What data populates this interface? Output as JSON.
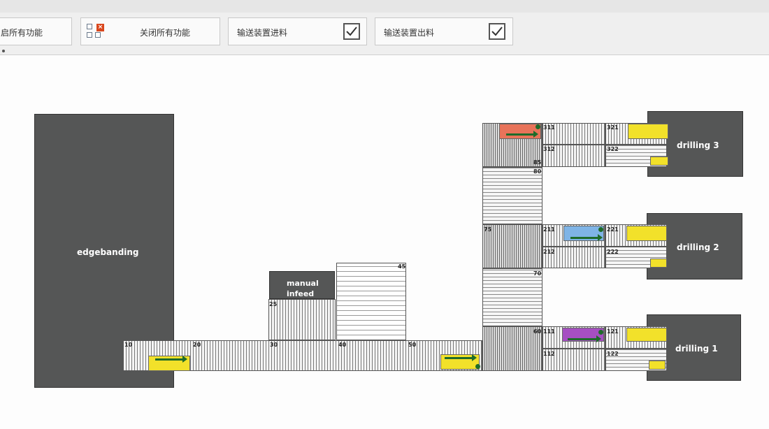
{
  "toolbar": {
    "btn_start_all": "启所有功能",
    "btn_stop_all": "关闭所有功能",
    "toggle_infeed": {
      "label": "输送装置进料",
      "checked": true
    },
    "toggle_outfeed": {
      "label": "输送装置出料",
      "checked": true
    }
  },
  "machines": {
    "edgebanding": "edgebanding",
    "manual_infeed": "manual infeed",
    "drilling_1": "drilling 1",
    "drilling_2": "drilling 2",
    "drilling_3": "drilling 3"
  },
  "conveyors": {
    "c10": "10",
    "c20": "20",
    "c25": "25",
    "c30": "30",
    "c40": "40",
    "c45": "45",
    "c50": "50",
    "c60": "60",
    "c70": "70",
    "c75": "75",
    "c80": "80",
    "c85": "85",
    "c111": "111",
    "c112": "112",
    "c121": "121",
    "c122": "122",
    "c211": "211",
    "c212": "212",
    "c221": "221",
    "c222": "222",
    "c311": "311",
    "c312": "312",
    "c321": "321",
    "c322": "322"
  },
  "colors": {
    "part_yellow": "#f2e12a",
    "part_red": "#e8735a",
    "part_blue": "#7fb4e6",
    "part_purple": "#a64fc2",
    "machine": "#555656",
    "arrow": "#1e6b2a"
  },
  "icons": {
    "stop_all_icon": "grid-with-x-icon",
    "checkbox_icon": "checkmark-icon",
    "flow_arrow": "right-arrow-icon"
  }
}
